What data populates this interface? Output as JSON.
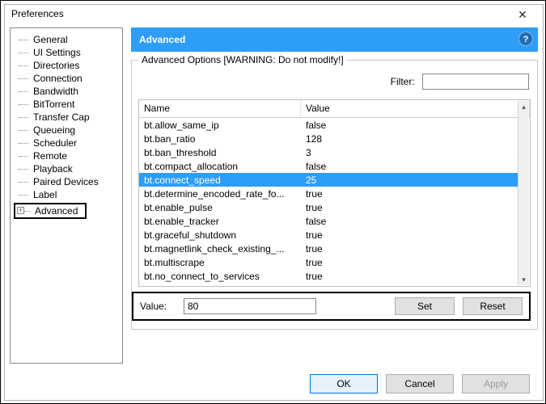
{
  "window": {
    "title": "Preferences"
  },
  "sidebar": {
    "items": [
      "General",
      "UI Settings",
      "Directories",
      "Connection",
      "Bandwidth",
      "BitTorrent",
      "Transfer Cap",
      "Queueing",
      "Scheduler",
      "Remote",
      "Playback",
      "Paired Devices",
      "Label"
    ],
    "advanced_label": "Advanced"
  },
  "panel": {
    "banner_title": "Advanced",
    "group_label": "Advanced Options [WARNING: Do not modify!]",
    "filter_label": "Filter:",
    "filter_value": "",
    "columns": {
      "name": "Name",
      "value": "Value"
    },
    "rows": [
      {
        "name": "bt.allow_same_ip",
        "value": "false"
      },
      {
        "name": "bt.ban_ratio",
        "value": "128"
      },
      {
        "name": "bt.ban_threshold",
        "value": "3"
      },
      {
        "name": "bt.compact_allocation",
        "value": "false"
      },
      {
        "name": "bt.connect_speed",
        "value": "25",
        "selected": true
      },
      {
        "name": "bt.determine_encoded_rate_fo...",
        "value": "true"
      },
      {
        "name": "bt.enable_pulse",
        "value": "true"
      },
      {
        "name": "bt.enable_tracker",
        "value": "false"
      },
      {
        "name": "bt.graceful_shutdown",
        "value": "true"
      },
      {
        "name": "bt.magnetlink_check_existing_...",
        "value": "true"
      },
      {
        "name": "bt.multiscrape",
        "value": "true"
      },
      {
        "name": "bt.no_connect_to_services",
        "value": "true"
      }
    ],
    "value_label": "Value:",
    "value_input": "80",
    "set_label": "Set",
    "reset_label": "Reset"
  },
  "buttons": {
    "ok": "OK",
    "cancel": "Cancel",
    "apply": "Apply"
  }
}
